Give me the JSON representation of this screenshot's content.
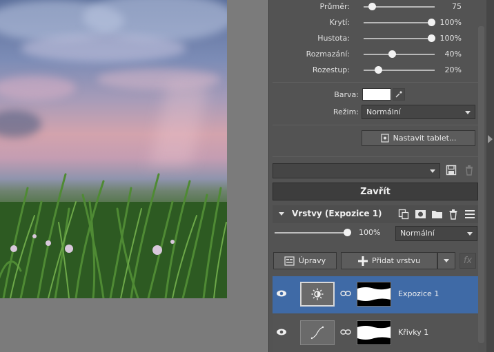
{
  "brush": {
    "sliders": [
      {
        "label": "Průměr:",
        "value": "75",
        "fraction": 0.12
      },
      {
        "label": "Krytí:",
        "value": "100%",
        "fraction": 0.95
      },
      {
        "label": "Hustota:",
        "value": "100%",
        "fraction": 0.95
      },
      {
        "label": "Rozmazání:",
        "value": "40%",
        "fraction": 0.4
      },
      {
        "label": "Rozestup:",
        "value": "20%",
        "fraction": 0.2
      }
    ],
    "color_label": "Barva:",
    "color_value": "#ffffff",
    "mode_label": "Režim:",
    "mode_value": "Normální",
    "tablet_button": "Nastavit tablet..."
  },
  "preset": {
    "value": ""
  },
  "close_button": "Zavřít",
  "layers": {
    "title": "Vrstvy (Expozice 1)",
    "opacity": "100%",
    "opacity_fraction": 1.0,
    "blend_mode": "Normální",
    "adjustments_button": "Úpravy",
    "add_layer_button": "Přidat vrstvu",
    "fx_label": "fx",
    "items": [
      {
        "name": "Expozice 1",
        "icon": "exposure-icon",
        "selected": true
      },
      {
        "name": "Křivky 1",
        "icon": "curves-icon",
        "selected": false
      }
    ]
  },
  "colors": {
    "selected_row": "#3f6aa6",
    "panel": "#535353"
  }
}
